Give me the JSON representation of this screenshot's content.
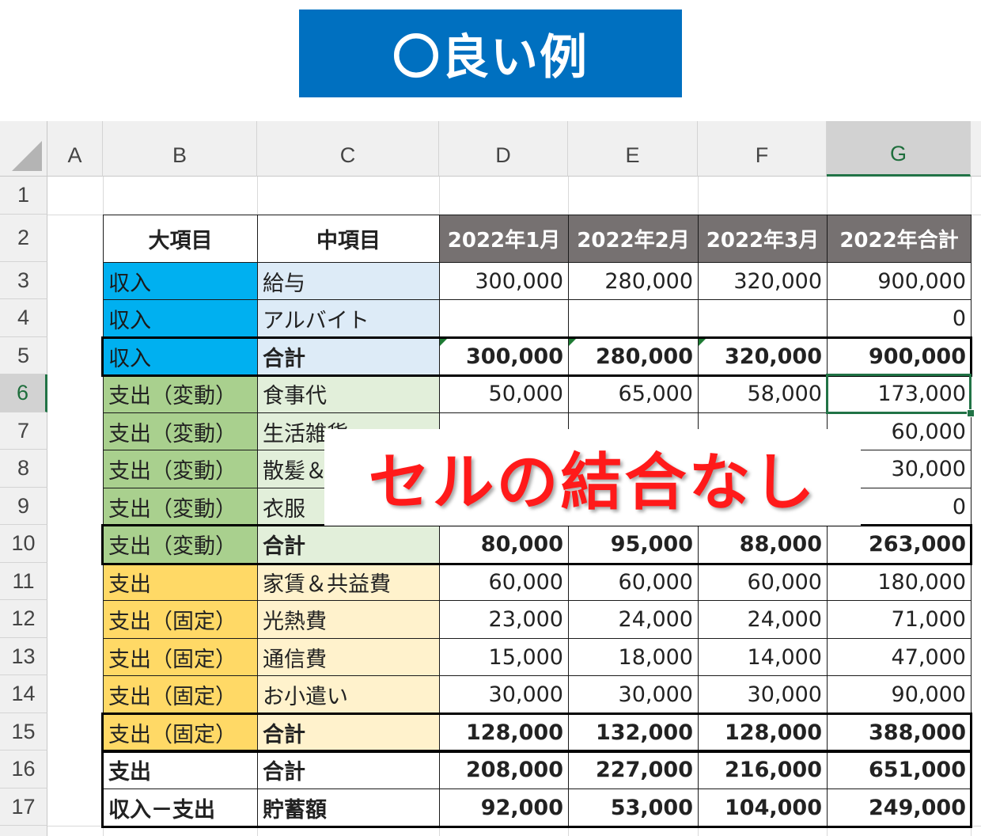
{
  "banner": {
    "text": "〇良い例",
    "color": "#0070c0"
  },
  "overlay": {
    "text": "セルの結合なし",
    "color": "#ff1a1a"
  },
  "sheet": {
    "columns": [
      "A",
      "B",
      "C",
      "D",
      "E",
      "F",
      "G"
    ],
    "active_column": "G",
    "rows": [
      "1",
      "2",
      "3",
      "4",
      "5",
      "6",
      "7",
      "8",
      "9",
      "10",
      "11",
      "12",
      "13",
      "14",
      "15",
      "16",
      "17"
    ],
    "active_row": "6",
    "selected_cell": "G6",
    "header": {
      "b": "大項目",
      "c": "中項目",
      "d": "2022年1月",
      "e": "2022年2月",
      "f": "2022年3月",
      "g": "2022年合計"
    },
    "table": [
      {
        "b": "収入",
        "c": "給与",
        "d": "300,000",
        "e": "280,000",
        "f": "320,000",
        "g": "900,000"
      },
      {
        "b": "収入",
        "c": "アルバイト",
        "d": "",
        "e": "",
        "f": "",
        "g": "0"
      },
      {
        "b": "収入",
        "c": "合計",
        "d": "300,000",
        "e": "280,000",
        "f": "320,000",
        "g": "900,000"
      },
      {
        "b": "支出（変動）",
        "c": "食事代",
        "d": "50,000",
        "e": "65,000",
        "f": "58,000",
        "g": "173,000"
      },
      {
        "b": "支出（変動）",
        "c": "生活雑貨",
        "d": "",
        "e": "",
        "f": "",
        "g": "60,000"
      },
      {
        "b": "支出（変動）",
        "c": "散髪＆",
        "d": "",
        "e": "",
        "f": "",
        "g": "30,000"
      },
      {
        "b": "支出（変動）",
        "c": "衣服",
        "d": "",
        "e": "",
        "f": "",
        "g": "0"
      },
      {
        "b": "支出（変動）",
        "c": "合計",
        "d": "80,000",
        "e": "95,000",
        "f": "88,000",
        "g": "263,000"
      },
      {
        "b": "支出",
        "c": "家賃＆共益費",
        "d": "60,000",
        "e": "60,000",
        "f": "60,000",
        "g": "180,000"
      },
      {
        "b": "支出（固定）",
        "c": "光熱費",
        "d": "23,000",
        "e": "24,000",
        "f": "24,000",
        "g": "71,000"
      },
      {
        "b": "支出（固定）",
        "c": "通信費",
        "d": "15,000",
        "e": "18,000",
        "f": "14,000",
        "g": "47,000"
      },
      {
        "b": "支出（固定）",
        "c": "お小遣い",
        "d": "30,000",
        "e": "30,000",
        "f": "30,000",
        "g": "90,000"
      },
      {
        "b": "支出（固定）",
        "c": "合計",
        "d": "128,000",
        "e": "132,000",
        "f": "128,000",
        "g": "388,000"
      },
      {
        "b": "支出",
        "c": "合計",
        "d": "208,000",
        "e": "227,000",
        "f": "216,000",
        "g": "651,000"
      },
      {
        "b": "収入－支出",
        "c": "貯蓄額",
        "d": "92,000",
        "e": "53,000",
        "f": "104,000",
        "g": "249,000"
      }
    ],
    "colors": {
      "header_dark": "#767171",
      "income": "#00b0f0",
      "income_light": "#ddebf7",
      "variable": "#a9d08e",
      "variable_light": "#e2efda",
      "fixed": "#ffd966",
      "fixed_light": "#fff2cc",
      "selection": "#217346"
    }
  }
}
